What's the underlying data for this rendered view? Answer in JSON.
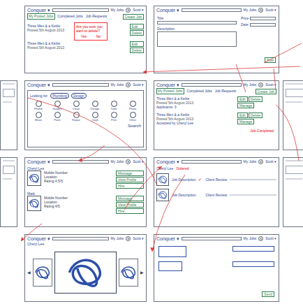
{
  "header": {
    "logo": "Conquer ▾",
    "nav": "My Jobs",
    "avatar": "S",
    "user": "Scott ▾"
  },
  "jobList": {
    "tabs": [
      {
        "label": "My Posted Jobs",
        "selected": true
      },
      {
        "label": "Completed Jobs",
        "selected": false
      },
      {
        "label": "Job Requests",
        "selected": false
      }
    ],
    "create": "Create Job",
    "jobs": [
      {
        "title": "Three Men & a Kettle",
        "posted": "Posted 5th August 2013",
        "actions": [
          "Edit",
          "Delete"
        ]
      },
      {
        "title": "Three Men & a Kettle",
        "posted": "Posted 5th August 2013",
        "actions": [
          "Edit",
          "Delete"
        ]
      }
    ],
    "dialog": {
      "text": "Are you sure you want to delete?",
      "buttons": [
        "Yes",
        "No"
      ]
    }
  },
  "createJob": {
    "fields": [
      "Title",
      "Description"
    ],
    "side": [
      "Price",
      "Date"
    ],
    "button": "Post"
  },
  "search": {
    "label": "Looking for:",
    "chips": [
      "Plumbing",
      "Design"
    ],
    "categories": [
      "Plumb",
      "Garden",
      "Clean",
      "Design",
      "Tutor",
      "Photo",
      "Move",
      "Paint",
      "Repair",
      "Cook",
      "Pets",
      "Other"
    ],
    "button": "Search"
  },
  "jobDetail": {
    "tabs": [
      {
        "label": "My Posted Jobs",
        "selected": true
      },
      {
        "label": "Completed Jobs",
        "selected": false
      },
      {
        "label": "Job Requests",
        "selected": false
      }
    ],
    "create": "Create Job",
    "jobs": [
      {
        "title": "Three Men & a Kettle",
        "posted": "Posted 5th August 2013",
        "note": "Applicants: 3"
      },
      {
        "title": "Three Men & a Kettle",
        "posted": "Posted 5th August 2013",
        "note": "Accepted by Cheryl Lee"
      }
    ],
    "buttons": [
      "Edit",
      "Delete",
      "Manage"
    ],
    "status": "Job Completed"
  },
  "freelancers": {
    "people": [
      {
        "name": "Cheryl Lee",
        "details": [
          "Mobile Number",
          "Location",
          "Rating 4.5/5"
        ],
        "buttons": [
          "Message",
          "View Profile",
          "Hire"
        ]
      },
      {
        "name": "Mark",
        "details": [
          "Mobile Number",
          "Location",
          "Rating 4/5"
        ],
        "buttons": [
          "Message",
          "View Profile",
          "Hire"
        ]
      }
    ]
  },
  "orders": {
    "name": "Cheryl Lee",
    "badge": "Ordered",
    "items": [
      {
        "title": "Job Description",
        "review": "Client Review",
        "done": true
      },
      {
        "title": "Job Description",
        "review": "Client Review",
        "done": false
      }
    ]
  },
  "gallery": {
    "name": "Cheryl Lee",
    "prev": "◀",
    "next": "▶"
  },
  "message": {
    "button": "Send"
  }
}
